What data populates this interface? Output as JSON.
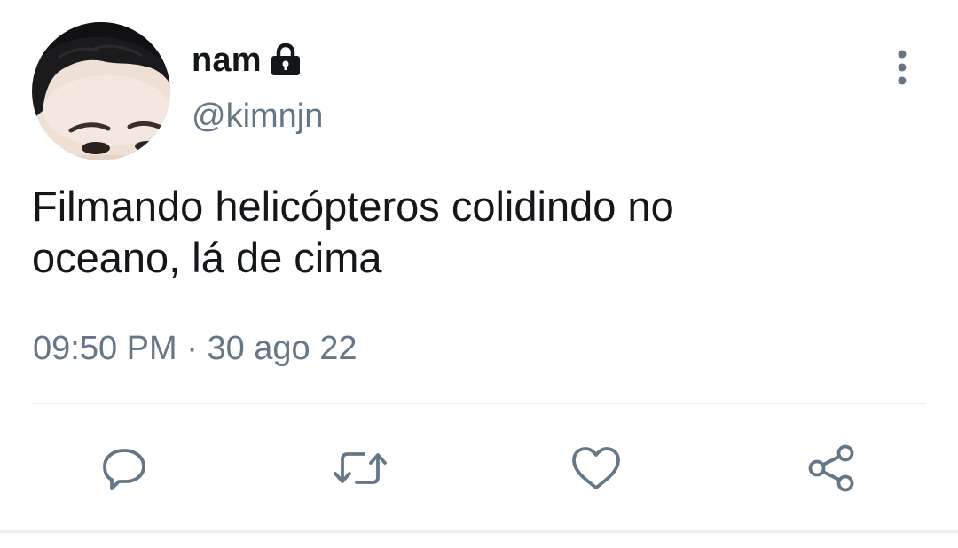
{
  "user": {
    "display_name": "nam",
    "handle": "@kimnjn",
    "protected_icon": "lock-icon",
    "avatar": "avatar-photo"
  },
  "tweet": {
    "text_line1": "Filmando helicópteros colidindo no",
    "text_line2": "oceano, lá de cima",
    "time": "09:50 PM",
    "separator": "·",
    "date": "30 ago 22"
  },
  "menu": {
    "icon": "more-vertical-icon"
  },
  "actions": [
    {
      "name": "reply",
      "icon": "reply-icon"
    },
    {
      "name": "retweet",
      "icon": "retweet-icon"
    },
    {
      "name": "like",
      "icon": "heart-icon"
    },
    {
      "name": "share",
      "icon": "share-icon"
    }
  ],
  "colors": {
    "text_primary": "#14171a",
    "text_secondary": "#657786",
    "icon": "#657786",
    "divider": "#e6ecf0"
  }
}
